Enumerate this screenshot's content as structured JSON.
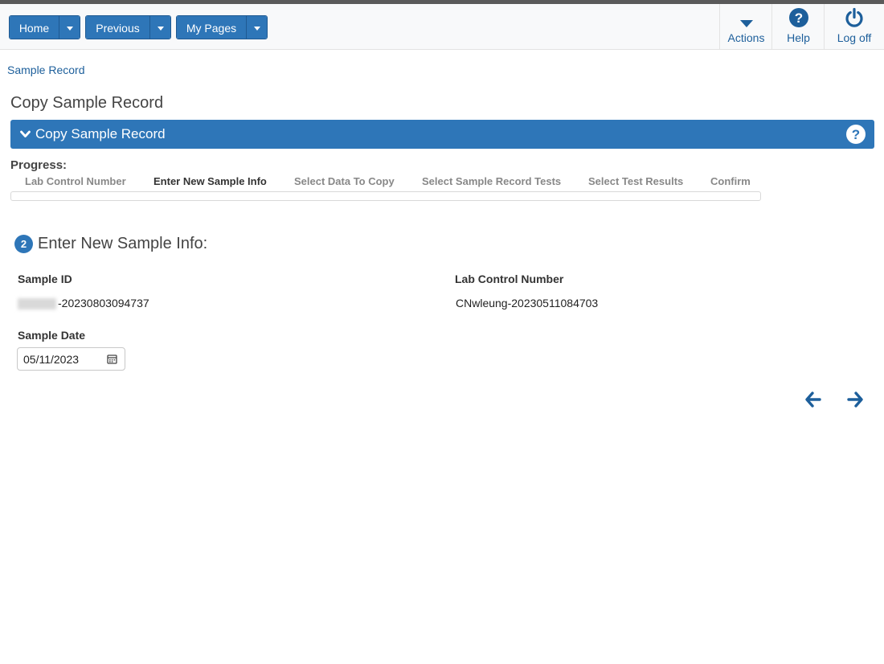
{
  "nav": {
    "home_label": "Home",
    "previous_label": "Previous",
    "mypages_label": "My Pages"
  },
  "tools": {
    "actions_label": "Actions",
    "help_label": "Help",
    "logoff_label": "Log off"
  },
  "breadcrumb": "Sample Record",
  "page_title": "Copy Sample Record",
  "panel": {
    "title": "Copy Sample Record"
  },
  "progress": {
    "label": "Progress:",
    "steps": [
      {
        "label": "Lab Control Number",
        "state": "done"
      },
      {
        "label": "Enter New Sample Info",
        "state": "active"
      },
      {
        "label": "Select Data To Copy",
        "state": "pending"
      },
      {
        "label": "Select Sample Record Tests",
        "state": "pending"
      },
      {
        "label": "Select Test Results",
        "state": "pending"
      },
      {
        "label": "Confirm",
        "state": "pending"
      }
    ]
  },
  "section": {
    "number": "2",
    "title": "Enter New Sample Info:"
  },
  "fields": {
    "sample_id_label": "Sample ID",
    "sample_id_value": "-20230803094737",
    "lab_control_label": "Lab Control Number",
    "lab_control_value": "CNwleung-20230511084703",
    "sample_date_label": "Sample Date",
    "sample_date_value": "05/11/2023"
  },
  "icons": {
    "actions": "caret-down-icon",
    "help": "question-circle-icon",
    "logoff": "power-icon",
    "calendar": "calendar-icon",
    "back": "arrow-left-icon",
    "next": "arrow-right-icon"
  },
  "colors": {
    "primary": "#2e76b8",
    "link": "#1d5f9b"
  }
}
